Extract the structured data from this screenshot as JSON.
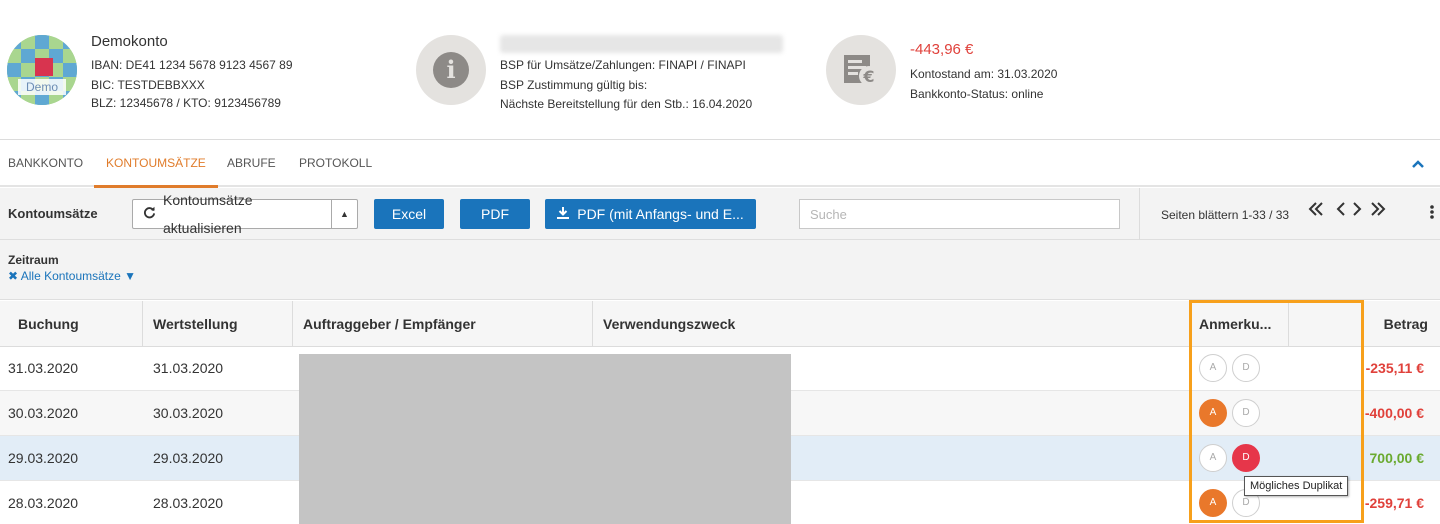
{
  "account": {
    "avatar_label": "Demo",
    "name": "Demokonto",
    "iban": "IBAN: DE41 1234 5678 9123 4567 89",
    "bic": "BIC: TESTDEBBXXX",
    "blz": "BLZ: 12345678 / KTO: 9123456789"
  },
  "bsp": {
    "line1": "BSP für Umsätze/Zahlungen: FINAPI / FINAPI",
    "line2": "BSP Zustimmung gültig bis:",
    "line3": "Nächste Bereitstellung für den Stb.: 16.04.2020"
  },
  "balance": {
    "amount": "-443,96 €",
    "amount_color": "#e0413b",
    "date": "Kontostand am: 31.03.2020",
    "status": "Bankkonto-Status: online"
  },
  "tabs": [
    {
      "label": "BANKKONTO",
      "active": false
    },
    {
      "label": "KONTOUMSÄTZE",
      "active": true
    },
    {
      "label": "ABRUFE",
      "active": false
    },
    {
      "label": "PROTOKOLL",
      "active": false
    }
  ],
  "toolbar": {
    "title": "Kontoumsätze",
    "refresh_label": "Kontoumsätze aktualisieren",
    "excel_label": "Excel",
    "pdf_label": "PDF",
    "pdf_full_label": "PDF (mit Anfangs- und E...",
    "search_placeholder": "Suche",
    "pager_text": "Seiten blättern 1-33 / 33"
  },
  "filter": {
    "title": "Zeitraum",
    "value": "Alle Kontoumsätze"
  },
  "table": {
    "headers": {
      "buchung": "Buchung",
      "wertstellung": "Wertstellung",
      "auftraggeber": "Auftraggeber / Empfänger",
      "verwendungszweck": "Verwendungszweck",
      "anmerkung": "Anmerku...",
      "betrag": "Betrag"
    },
    "rows": [
      {
        "buchung": "31.03.2020",
        "wertstellung": "31.03.2020",
        "badge_a": "A",
        "badge_d": "D",
        "a_state": "empty",
        "d_state": "empty",
        "betrag": "-235,11 €",
        "betrag_color": "#e0413b"
      },
      {
        "buchung": "30.03.2020",
        "wertstellung": "30.03.2020",
        "badge_a": "A",
        "badge_d": "D",
        "a_state": "orange",
        "d_state": "empty",
        "betrag": "-400,00 €",
        "betrag_color": "#e0413b"
      },
      {
        "buchung": "29.03.2020",
        "wertstellung": "29.03.2020",
        "badge_a": "A",
        "badge_d": "D",
        "a_state": "empty",
        "d_state": "red",
        "betrag": "700,00 €",
        "betrag_color": "#6aaa2f"
      },
      {
        "buchung": "28.03.2020",
        "wertstellung": "28.03.2020",
        "badge_a": "A",
        "badge_d": "D",
        "a_state": "orange",
        "d_state": "empty",
        "betrag": "-259,71 €",
        "betrag_color": "#e0413b"
      }
    ]
  },
  "tooltip": "Mögliches Duplikat",
  "colors": {
    "accent_blue": "#1a74bb",
    "accent_orange": "#e07c2b",
    "highlight": "#f7a01b"
  }
}
